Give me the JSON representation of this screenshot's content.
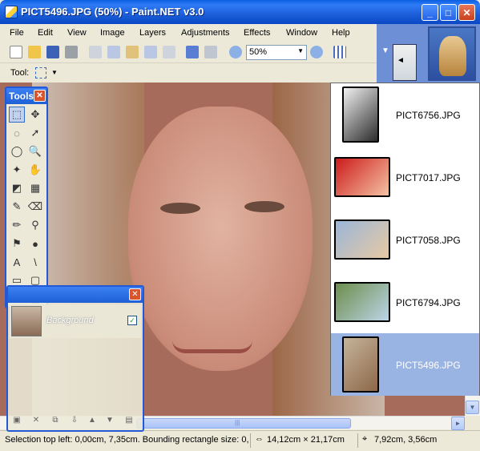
{
  "window": {
    "title": "PICT5496.JPG (50%) - Paint.NET v3.0",
    "controls": {
      "minimize": "_",
      "maximize": "□",
      "close": "✕"
    }
  },
  "menu": [
    "File",
    "Edit",
    "View",
    "Image",
    "Layers",
    "Adjustments",
    "Effects",
    "Window",
    "Help"
  ],
  "toolbar": {
    "zoom_value": "50%",
    "zoom_arrow": "▼",
    "icons": [
      "new-icon",
      "open-icon",
      "save-icon",
      "print-icon",
      "cut-icon",
      "copy-icon",
      "paste-icon",
      "crop-icon",
      "deselect-icon",
      "undo-icon",
      "redo-icon",
      "zoom-out-icon",
      "zoom-in-icon",
      "grid-icon"
    ]
  },
  "tool_row": {
    "label": "Tool:",
    "current_tool_icon": "rectangle-select-icon",
    "arrow": "▼"
  },
  "image_strip": {
    "arrow": "◄"
  },
  "tools_window": {
    "title": "Tools",
    "close": "✕",
    "tools": [
      {
        "name": "rectangle-select-icon",
        "glyph": "⬚"
      },
      {
        "name": "move-selection-icon",
        "glyph": "✥"
      },
      {
        "name": "lasso-select-icon",
        "glyph": "◌"
      },
      {
        "name": "move-selected-icon",
        "glyph": "➚"
      },
      {
        "name": "ellipse-select-icon",
        "glyph": "◯"
      },
      {
        "name": "zoom-icon",
        "glyph": "🔍"
      },
      {
        "name": "magic-wand-icon",
        "glyph": "✦"
      },
      {
        "name": "pan-icon",
        "glyph": "✋"
      },
      {
        "name": "paint-bucket-icon",
        "glyph": "◩"
      },
      {
        "name": "gradient-icon",
        "glyph": "▦"
      },
      {
        "name": "paintbrush-icon",
        "glyph": "✎"
      },
      {
        "name": "eraser-icon",
        "glyph": "⌫"
      },
      {
        "name": "pencil-icon",
        "glyph": "✏"
      },
      {
        "name": "color-picker-icon",
        "glyph": "⚲"
      },
      {
        "name": "clone-stamp-icon",
        "glyph": "⚑"
      },
      {
        "name": "recolor-icon",
        "glyph": "●"
      },
      {
        "name": "text-icon",
        "glyph": "A"
      },
      {
        "name": "line-curve-icon",
        "glyph": "\\"
      },
      {
        "name": "rectangle-icon",
        "glyph": "▭"
      },
      {
        "name": "rounded-rectangle-icon",
        "glyph": "▢"
      },
      {
        "name": "ellipse-icon",
        "glyph": "⬭"
      },
      {
        "name": "freeform-shape-icon",
        "glyph": "◭"
      }
    ]
  },
  "layers_window": {
    "close": "✕",
    "layer_name": "Background",
    "layer_visible_check": "✓",
    "tool_icons": [
      "add-layer-icon",
      "delete-layer-icon",
      "duplicate-layer-icon",
      "merge-layer-down-icon",
      "move-layer-up-icon",
      "move-layer-down-icon",
      "layer-properties-icon"
    ]
  },
  "image_list": [
    {
      "name": "PICT6756.JPG",
      "selected": false,
      "colors": [
        "#f1f1f1",
        "#2b2b2b"
      ]
    },
    {
      "name": "PICT7017.JPG",
      "selected": false,
      "colors": [
        "#cc1b1b",
        "#f4c2a2"
      ]
    },
    {
      "name": "PICT7058.JPG",
      "selected": false,
      "colors": [
        "#9bb6d8",
        "#e7c9a4"
      ]
    },
    {
      "name": "PICT6794.JPG",
      "selected": false,
      "colors": [
        "#6c8e4c",
        "#bcd4e7"
      ]
    },
    {
      "name": "PICT5496.JPG",
      "selected": true,
      "colors": [
        "#c5b39a",
        "#8d6848"
      ]
    }
  ],
  "status": {
    "selection": "Selection top left: 0,00cm, 7,35cm. Bounding rectangle size: 0,",
    "image_size": "14,12cm × 21,17cm",
    "cursor": "7,92cm, 3,56cm"
  },
  "scroll": {
    "up": "▲",
    "down": "▼",
    "left": "◄",
    "right": "►",
    "grip": "|||"
  }
}
